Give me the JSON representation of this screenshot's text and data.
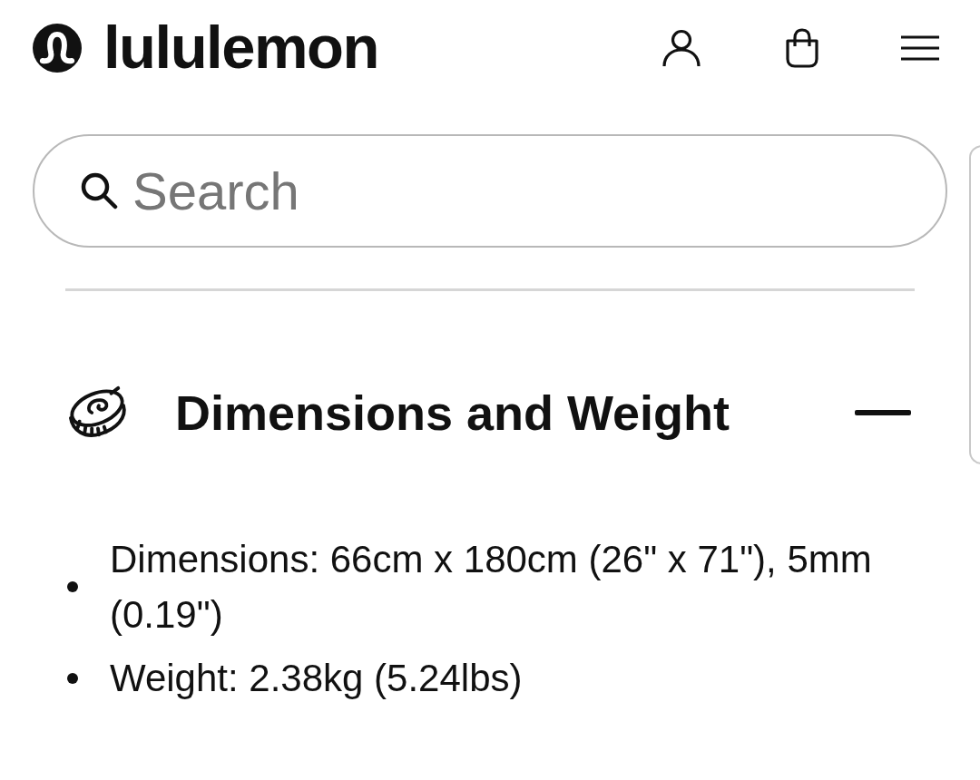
{
  "header": {
    "wordmark": "lululemon"
  },
  "search": {
    "placeholder": "Search"
  },
  "accordion": {
    "title": "Dimensions and Weight",
    "expanded": true,
    "items": [
      "Dimensions: 66cm x 180cm (26\" x 71\"), 5mm (0.19\")",
      "Weight: 2.38kg (5.24lbs)"
    ]
  }
}
